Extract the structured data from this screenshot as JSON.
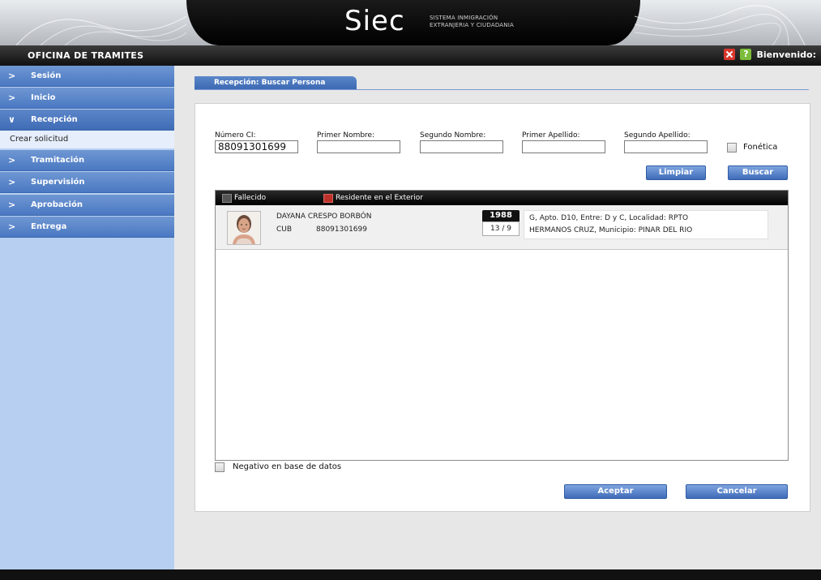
{
  "header": {
    "logo_text": "Siec",
    "logo_sub_line1": "SISTEMA INMIGRACIÓN",
    "logo_sub_line2": "EXTRANJERIA Y CIUDADANIA"
  },
  "titlebar": {
    "office": "OFICINA DE TRAMITES",
    "welcome": "Bienvenido:"
  },
  "sidebar": {
    "items": [
      {
        "label": "Sesión",
        "chevron": ">"
      },
      {
        "label": "Inicio",
        "chevron": ">"
      },
      {
        "label": "Recepción",
        "chevron": "∨"
      },
      {
        "label": "Tramitación",
        "chevron": ">"
      },
      {
        "label": "Supervisión",
        "chevron": ">"
      },
      {
        "label": "Aprobación",
        "chevron": ">"
      },
      {
        "label": "Entrega",
        "chevron": ">"
      }
    ],
    "subitem": "Crear solicitud"
  },
  "tab": {
    "label": "Recepción: Buscar Persona"
  },
  "search": {
    "ci_label": "Número CI:",
    "ci_value": "88091301699",
    "primer_nombre_label": "Primer Nombre:",
    "segundo_nombre_label": "Segundo Nombre:",
    "primer_apellido_label": "Primer Apellido:",
    "segundo_apellido_label": "Segundo Apellido:",
    "fonetica_label": "Fonética",
    "limpiar": "Limpiar",
    "buscar": "Buscar"
  },
  "legend": {
    "fallecido": "Fallecido",
    "residente": "Residente en el Exterior",
    "colors": {
      "fallecido": "#555555",
      "residente": "#c0302a"
    }
  },
  "results": [
    {
      "name": "DAYANA CRESPO BORBÓN",
      "nationality": "CUB",
      "ci": "88091301699",
      "year": "1988",
      "day_month": "13 / 9",
      "address_line1": "G, Apto. D10, Entre: D y C, Localidad: RPTO",
      "address_line2": "HERMANOS CRUZ, Municipio: PINAR DEL RIO"
    }
  ],
  "footer": {
    "negativo_label": "Negativo en base de datos",
    "aceptar": "Aceptar",
    "cancelar": "Cancelar"
  }
}
